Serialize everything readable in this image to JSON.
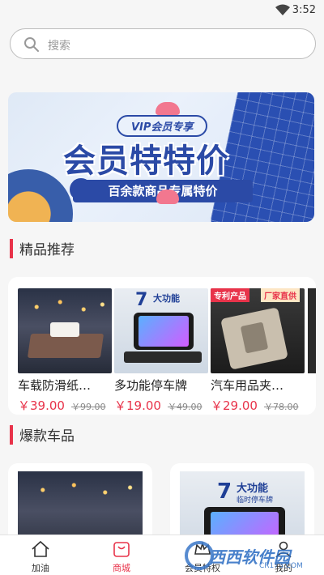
{
  "status": {
    "time": "3:52"
  },
  "search": {
    "placeholder": "搜索"
  },
  "banner": {
    "vip_label": "VIP会员专享",
    "title": "会员特特价",
    "subtitle": "百余款商品专属特价"
  },
  "sections": {
    "featured": "精品推荐",
    "hot": "爆款车品"
  },
  "products": [
    {
      "name": "车载防滑纸…",
      "price": "￥39.00",
      "old_price": "￥99.00"
    },
    {
      "name": "多功能停车牌",
      "price": "￥19.00",
      "old_price": "￥49.00",
      "badge_number": "7",
      "badge_text": "大功能"
    },
    {
      "name": "汽车用品夹…",
      "price": "￥29.00",
      "old_price": "￥78.00",
      "tag1": "专利产品",
      "tag2": "厂家直供"
    }
  ],
  "hot_products": [
    {
      "id": "tissue"
    },
    {
      "id": "phone",
      "badge_number": "7",
      "badge_text": "大功能",
      "badge_sub": "临时停车牌"
    }
  ],
  "tabbar": [
    {
      "label": "加油",
      "icon": "home-icon"
    },
    {
      "label": "商城",
      "icon": "shop-bag-icon",
      "active": true
    },
    {
      "label": "会员特权",
      "icon": "crown-icon"
    },
    {
      "label": "我的",
      "icon": "user-icon"
    }
  ],
  "watermark": {
    "text": "西西软件园",
    "url": "CR173.COM"
  },
  "colors": {
    "accent": "#e8334a",
    "banner_blue": "#2b4aa6"
  }
}
